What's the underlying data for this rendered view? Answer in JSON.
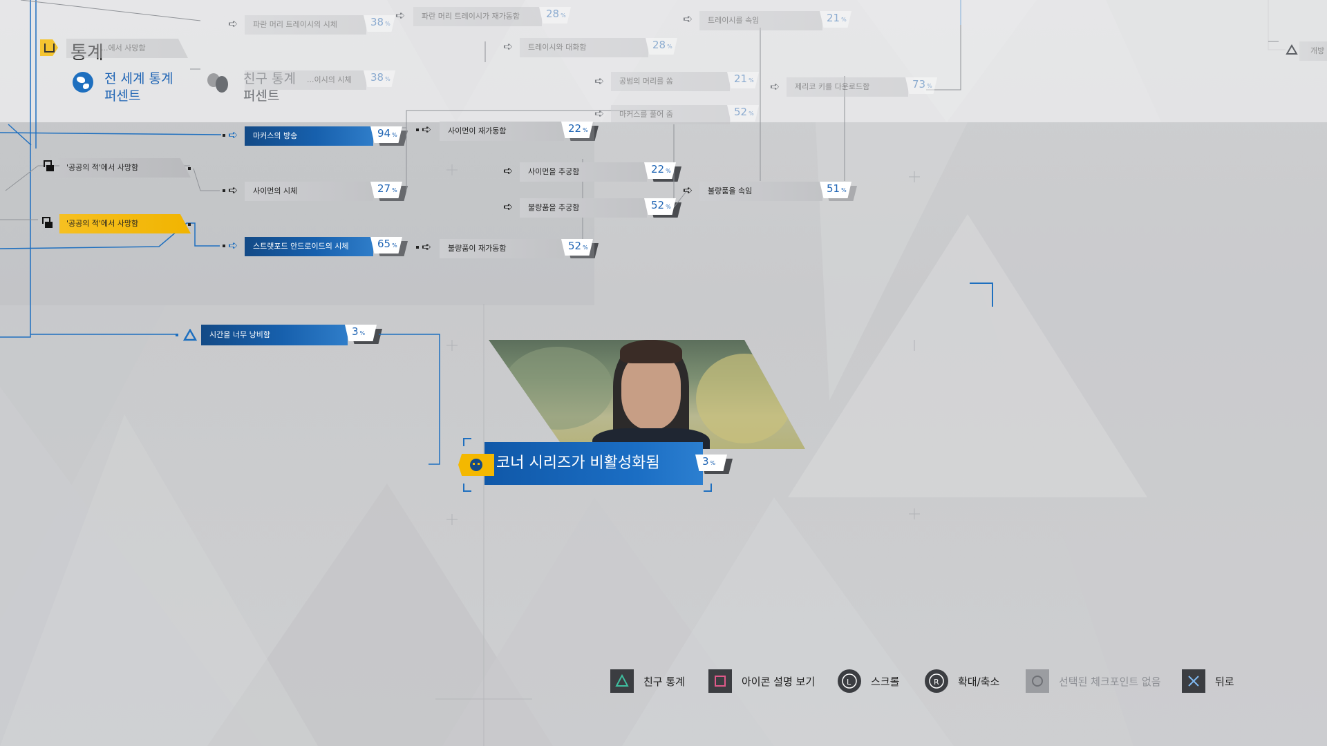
{
  "header": {
    "title": "통계",
    "tabs": [
      {
        "label": "전 세계 통계",
        "sub": "퍼센트"
      },
      {
        "label": "친구 통계",
        "sub": "퍼센트"
      }
    ]
  },
  "colors": {
    "accent_blue": "#1b6ec4",
    "flag_yellow": "#f4b800",
    "text_dark": "#222222"
  },
  "nodes": {
    "faded_top1": {
      "label": "파란 머리 트레이시의 시체",
      "pct": "38"
    },
    "faded_top2": {
      "label": "파란 머리 트레이시가 재가동함",
      "pct": "28"
    },
    "faded_top3": {
      "label": "트레이시와 대화함",
      "pct": "28"
    },
    "faded_top4": {
      "label": "트레이시를 속임",
      "pct": "21"
    },
    "faded_top5": {
      "label": "...에서 사망함"
    },
    "faded_top6": {
      "label": "...이시의 시체",
      "pct": "38"
    },
    "faded_top7": {
      "label": "공범의 머리를 쏨",
      "pct": "21"
    },
    "faded_top8": {
      "label": "제리코 키를 다운로드함",
      "pct": "73"
    },
    "faded_top9": {
      "label": "마커스를 풀어 줌",
      "pct": "52"
    },
    "faded_top10": {
      "label": "개방"
    },
    "markus_ram": {
      "label": "마커스의 방송",
      "pct": "94"
    },
    "simon_reactivated": {
      "label": "사이먼이 재가동함",
      "pct": "22"
    },
    "chased_simon": {
      "label": "사이먼을 추궁함",
      "pct": "22"
    },
    "deceived_defective": {
      "label": "불량품을 속임",
      "pct": "51"
    },
    "died_public_enemy1": {
      "label": "'공공의 적'에서 사망함"
    },
    "simon_body": {
      "label": "사이먼의 시체",
      "pct": "27"
    },
    "chased_defective": {
      "label": "불량품을 추궁함",
      "pct": "52"
    },
    "died_public_enemy2": {
      "label": "'공공의 적'에서 사망함"
    },
    "stratford_body": {
      "label": "스트랫포드 안드로이드의 시체",
      "pct": "65"
    },
    "defective_reactivated": {
      "label": "불량품이 재가동함",
      "pct": "52"
    },
    "wasted_time": {
      "label": "시간을 너무 낭비함",
      "pct": "3"
    },
    "connor_deactivated": {
      "label": "코너 시리즈가 비활성화됨",
      "pct": "3"
    }
  },
  "percent_sign": "%",
  "controls": [
    {
      "icon": "triangle-icon",
      "label": "친구 통계"
    },
    {
      "icon": "square-icon",
      "label": "아이콘 설명 보기"
    },
    {
      "icon": "left-stick-icon",
      "label": "스크롤"
    },
    {
      "icon": "right-stick-icon",
      "label": "확대/축소"
    },
    {
      "icon": "circle-icon",
      "label": "선택된 체크포인트 없음"
    },
    {
      "icon": "cross-icon",
      "label": "뒤로"
    }
  ]
}
